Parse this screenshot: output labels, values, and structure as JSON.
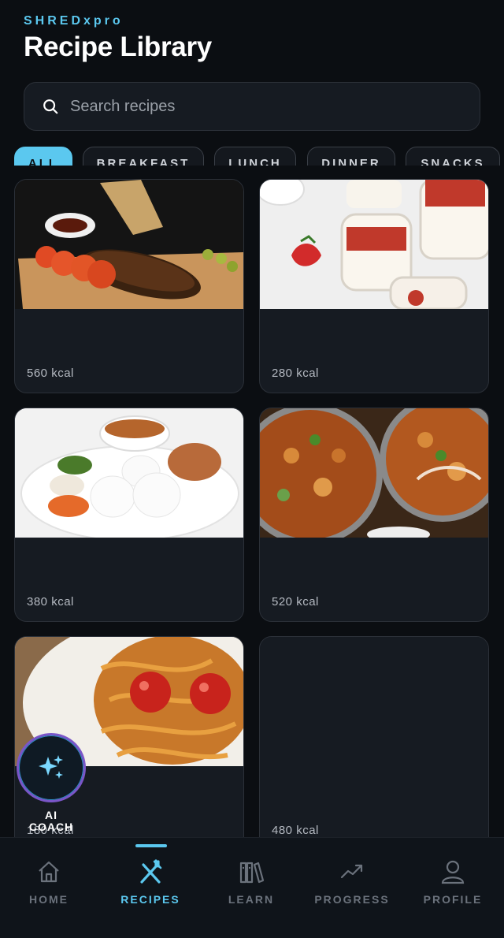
{
  "header": {
    "brand": "SHREDxpro",
    "title": "Recipe Library"
  },
  "search": {
    "placeholder": "Search recipes"
  },
  "filters": [
    {
      "label": "ALL",
      "active": true
    },
    {
      "label": "BREAKFAST",
      "active": false
    },
    {
      "label": "LUNCH",
      "active": false
    },
    {
      "label": "DINNER",
      "active": false
    },
    {
      "label": "SNACKS",
      "active": false
    }
  ],
  "recipes": [
    {
      "kcal": "560 kcal",
      "image": "ribs-platter"
    },
    {
      "kcal": "280 kcal",
      "image": "strawberry-panna-cotta"
    },
    {
      "kcal": "380 kcal",
      "image": "idli-sambar-plate"
    },
    {
      "kcal": "520 kcal",
      "image": "vegetable-curry"
    },
    {
      "kcal": "180 kcal",
      "image": "spaghetti-tomato"
    },
    {
      "kcal": "480 kcal",
      "image": ""
    }
  ],
  "ai_coach": {
    "label": "AI COACH",
    "icon": "sparkles-icon"
  },
  "tabs": [
    {
      "label": "HOME",
      "icon": "home-icon",
      "active": false
    },
    {
      "label": "RECIPES",
      "icon": "utensils-icon",
      "active": true
    },
    {
      "label": "LEARN",
      "icon": "books-icon",
      "active": false
    },
    {
      "label": "PROGRESS",
      "icon": "trend-up-icon",
      "active": false
    },
    {
      "label": "PROFILE",
      "icon": "user-icon",
      "active": false
    }
  ],
  "colors": {
    "accent": "#5bc8ef",
    "background": "#0b0e12",
    "card": "#161b22"
  }
}
